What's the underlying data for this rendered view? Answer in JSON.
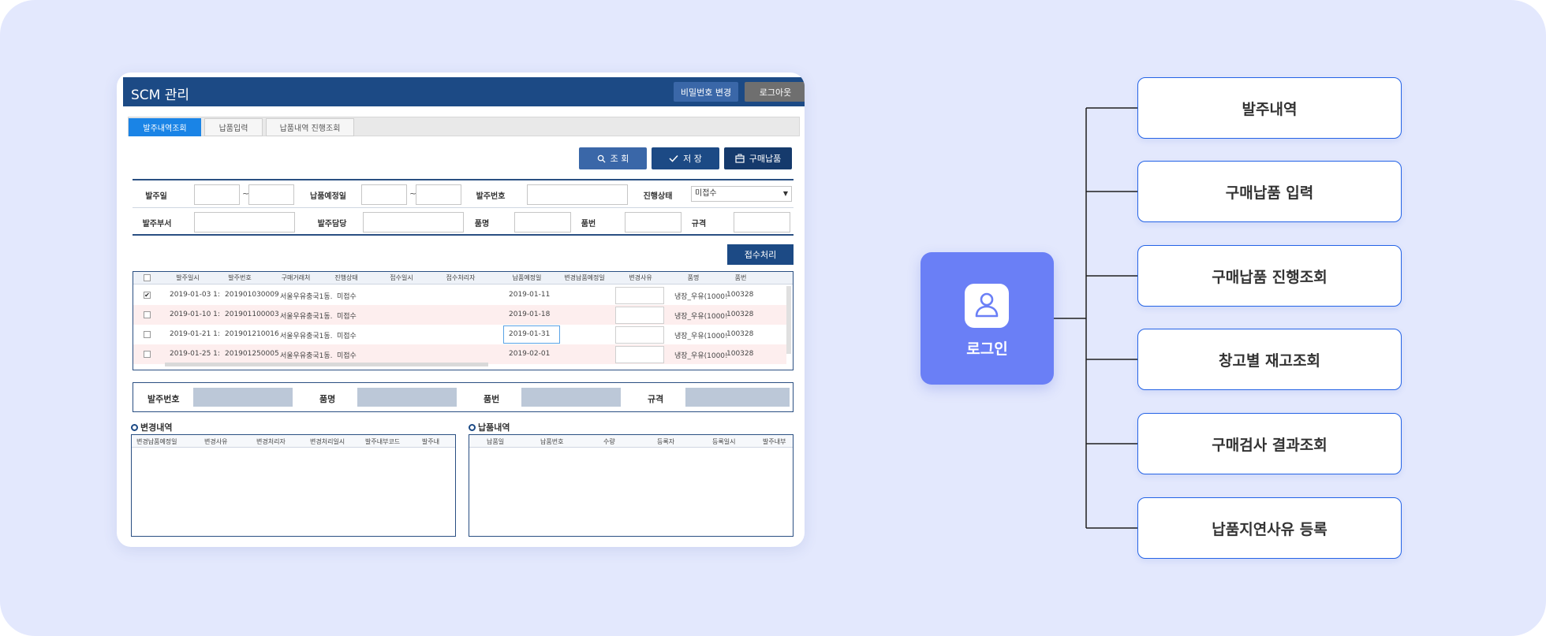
{
  "window": {
    "title": "SCM 관리",
    "change_password": "비밀번호 변경",
    "logout": "로그아웃"
  },
  "tabs": [
    "발주내역조회",
    "납품입력",
    "납품내역 진행조회"
  ],
  "actions": {
    "search": "조 회",
    "save": "저 장",
    "purchase": "구매납품"
  },
  "form": {
    "order_date": "발주일",
    "delivery_due": "납품예정일",
    "order_no": "발주번호",
    "status": "진행상태",
    "status_value": "미접수",
    "order_dept": "발주부서",
    "order_manager": "발주담당",
    "item_name": "품명",
    "item_no": "품번",
    "spec": "규격",
    "tilde": "~"
  },
  "accept_button": "접수처리",
  "grid": {
    "columns": [
      "발주일시",
      "발주번호",
      "구매거래처",
      "진행상태",
      "접수일시",
      "접수처리자",
      "납품예정일",
      "변경납품예정일",
      "변경사유",
      "품명",
      "품번"
    ],
    "rows": [
      {
        "checked": "✔",
        "date": "2019-01-03 1:",
        "no": "201901030009",
        "vendor": "서울우유충국1동.",
        "status": "미접수",
        "due": "2019-01-11",
        "item": "냉장_우유(1000!",
        "code": "100328"
      },
      {
        "checked": "",
        "date": "2019-01-10 1:",
        "no": "201901100003",
        "vendor": "서울우유충국1동.",
        "status": "미접수",
        "due": "2019-01-18",
        "item": "냉장_우유(1000!",
        "code": "100328"
      },
      {
        "checked": "",
        "date": "2019-01-21 1:",
        "no": "201901210016",
        "vendor": "서울우유충국1동.",
        "status": "미접수",
        "due": "2019-01-31",
        "item": "냉장_우유(1000!",
        "code": "100328"
      },
      {
        "checked": "",
        "date": "2019-01-25 1:",
        "no": "201901250005",
        "vendor": "서울우유충국1동.",
        "status": "미접수",
        "due": "2019-02-01",
        "item": "냉장_우유(1000!",
        "code": "100328"
      }
    ]
  },
  "detail": {
    "order_no": "발주번호",
    "item_name": "품명",
    "item_no": "품번",
    "spec": "규격"
  },
  "change_history": {
    "title": "변경내역",
    "columns": [
      "변경납품예정일",
      "변경사유",
      "변경처리자",
      "변경처리일시",
      "발주내부코드",
      "발주내"
    ]
  },
  "delivery_history": {
    "title": "납품내역",
    "columns": [
      "납품일",
      "납품번호",
      "수량",
      "등록자",
      "등록일시",
      "발주내부"
    ]
  },
  "diagram": {
    "login": "로그인",
    "menus": [
      "발주내역",
      "구매납품 입력",
      "구매납품 진행조회",
      "창고별 재고조회",
      "구매검사 결과조회",
      "납품지연사유 등록"
    ]
  },
  "colors": {
    "background": "#e3e8fd",
    "header": "#1c4a85",
    "login_box": "#6a7ff6",
    "menu_border": "#2463e6"
  }
}
